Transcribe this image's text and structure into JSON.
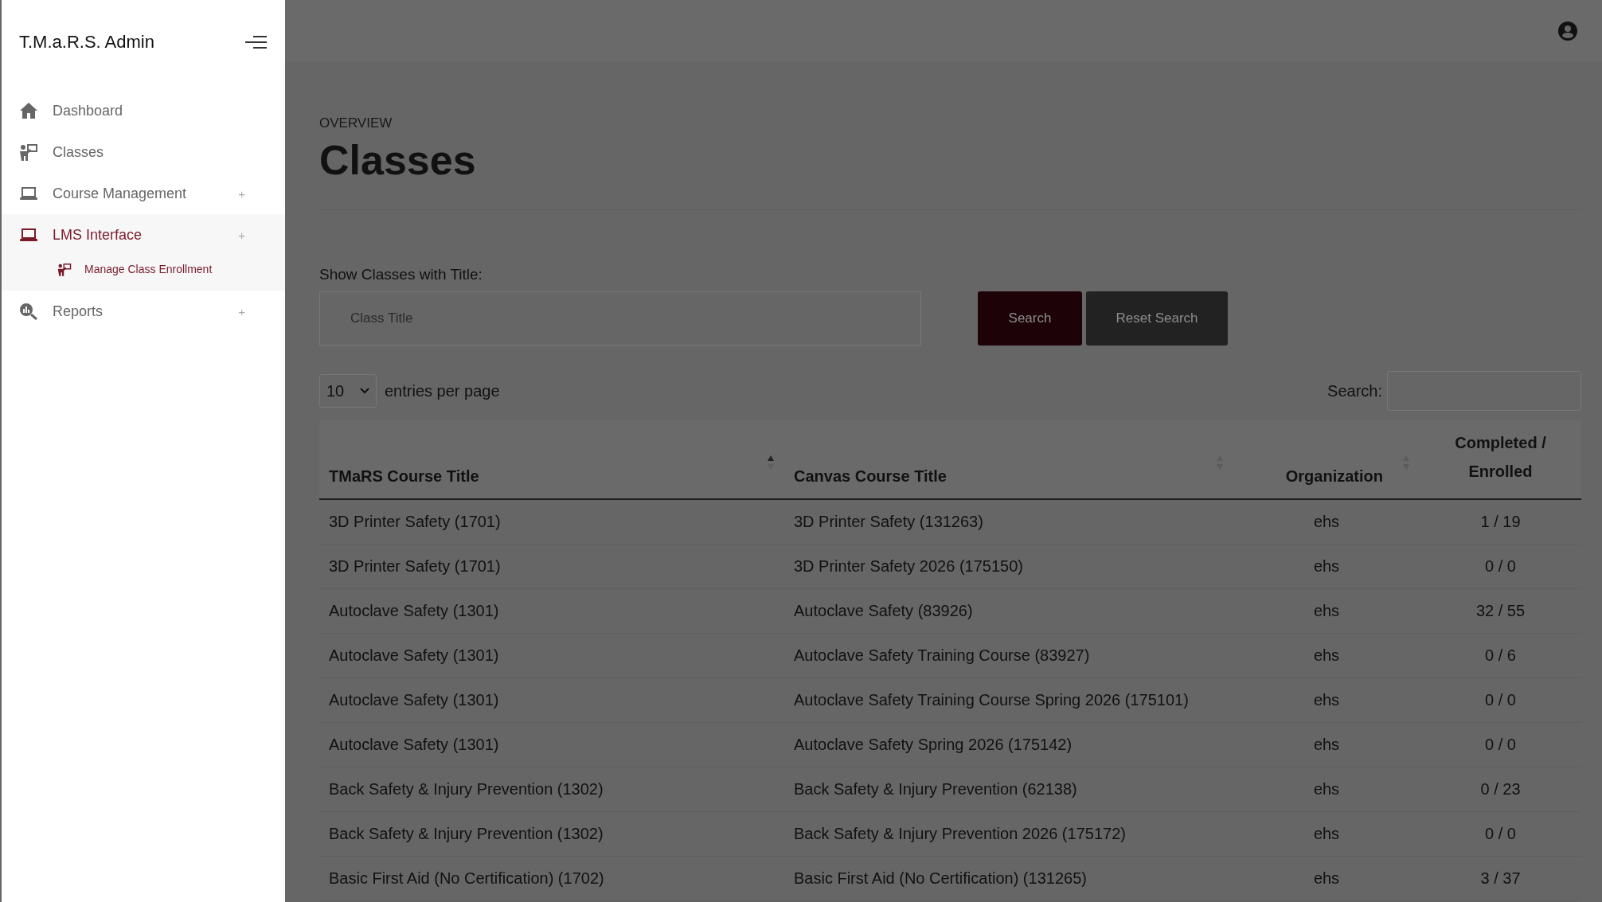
{
  "sidebar": {
    "brand": "T.M.a.R.S. Admin",
    "items": [
      {
        "label": "Dashboard",
        "selected": false
      },
      {
        "label": "Classes",
        "selected": false
      },
      {
        "label": "Course Management",
        "selected": false,
        "toggle": "+"
      },
      {
        "label": "LMS Interface",
        "selected": true,
        "toggle": "+",
        "children": [
          {
            "label": "Manage Class Enrollment",
            "selected": true
          }
        ]
      },
      {
        "label": "Reports",
        "selected": false,
        "toggle": "+"
      }
    ]
  },
  "page": {
    "eyebrow": "OVERVIEW",
    "title": "Classes"
  },
  "filter": {
    "label": "Show Classes with Title:",
    "placeholder": "Class Title",
    "buttons": [
      {
        "label": "Search",
        "kind": "primary"
      },
      {
        "label": "Reset Search",
        "kind": "dark"
      }
    ]
  },
  "table": {
    "page_size": "10",
    "page_size_label": "entries per page",
    "search_label": "Search:",
    "columns": [
      {
        "label": "TMaRS Course Title",
        "sortable": true,
        "sorted": true
      },
      {
        "label": "Canvas Course Title",
        "sortable": true,
        "sorted": false
      },
      {
        "label": "Organization",
        "sortable": true,
        "sorted": false
      },
      {
        "label": "Completed / Enrolled",
        "sortable": false
      }
    ],
    "rows": [
      [
        "3D Printer Safety (1701)",
        "3D Printer Safety (131263)",
        "ehs",
        "1 / 19"
      ],
      [
        "3D Printer Safety (1701)",
        "3D Printer Safety 2026 (175150)",
        "ehs",
        "0 / 0"
      ],
      [
        "Autoclave Safety (1301)",
        "Autoclave Safety (83926)",
        "ehs",
        "32 / 55"
      ],
      [
        "Autoclave Safety (1301)",
        "Autoclave Safety Training Course (83927)",
        "ehs",
        "0 / 6"
      ],
      [
        "Autoclave Safety (1301)",
        "Autoclave Safety Training Course Spring 2026 (175101)",
        "ehs",
        "0 / 0"
      ],
      [
        "Autoclave Safety (1301)",
        "Autoclave Safety Spring 2026 (175142)",
        "ehs",
        "0 / 0"
      ],
      [
        "Back Safety & Injury Prevention (1302)",
        "Back Safety & Injury Prevention (62138)",
        "ehs",
        "0 / 23"
      ],
      [
        "Back Safety & Injury Prevention (1302)",
        "Back Safety & Injury Prevention 2026 (175172)",
        "ehs",
        "0 / 0"
      ],
      [
        "Basic First Aid (No Certification) (1702)",
        "Basic First Aid (No Certification) (131265)",
        "ehs",
        "3 / 37"
      ]
    ]
  }
}
